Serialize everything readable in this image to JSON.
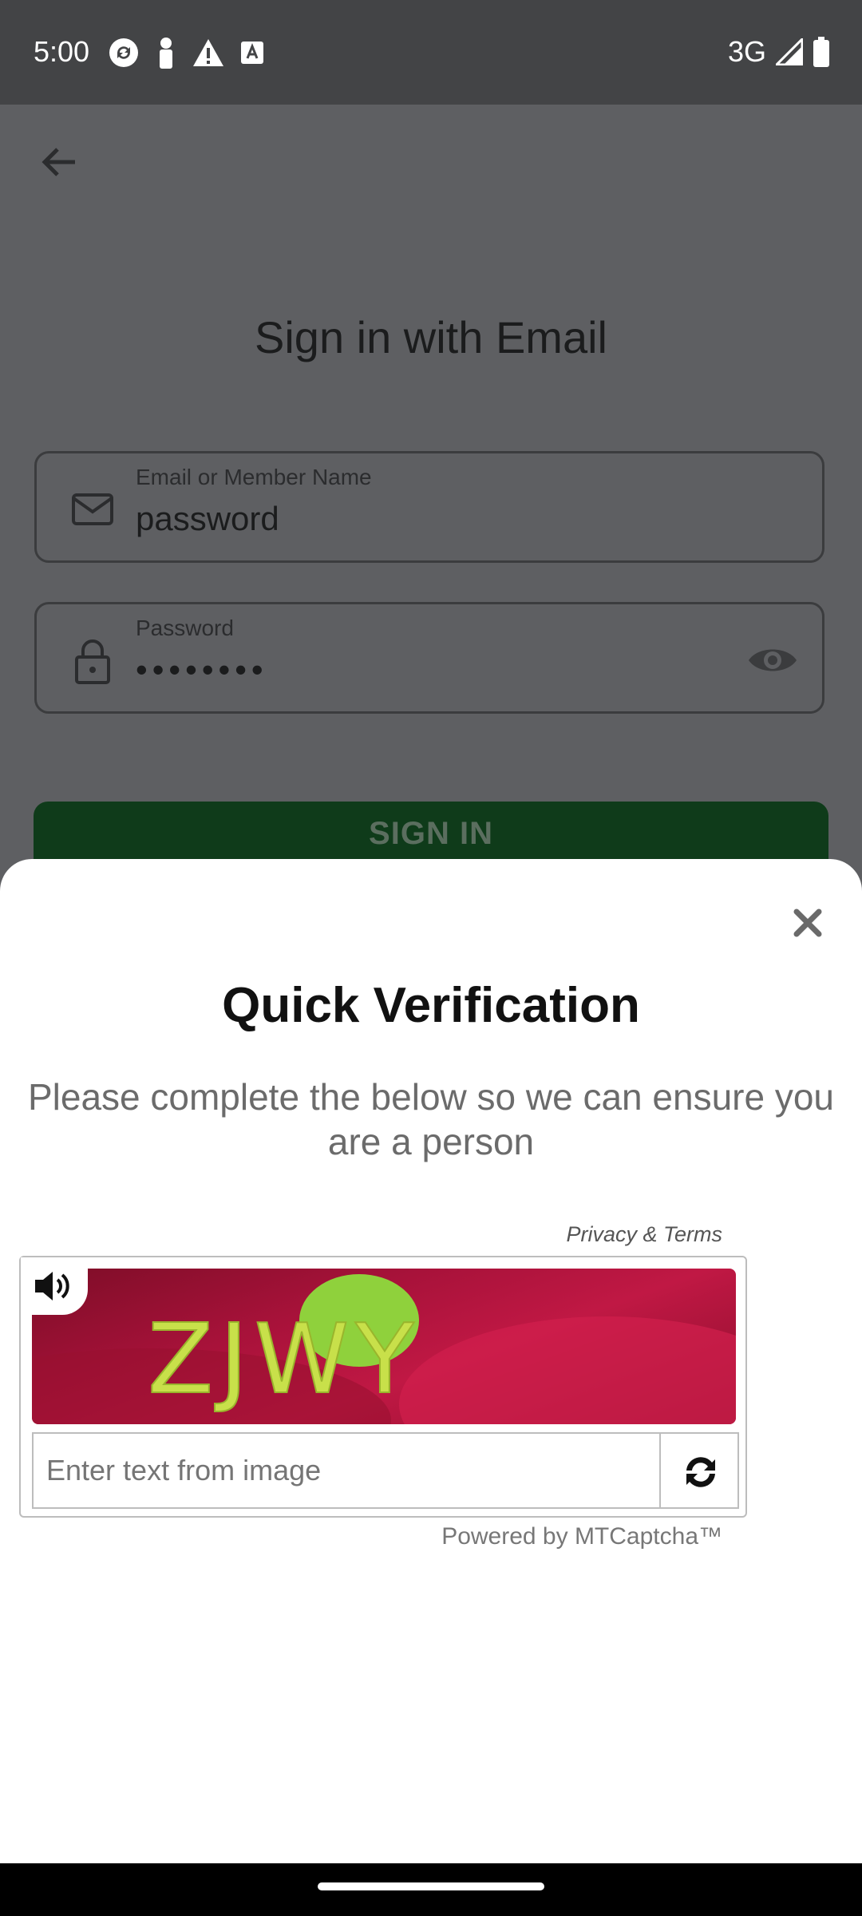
{
  "status_bar": {
    "time": "5:00",
    "network": "3G",
    "icons_left": [
      "sync-icon",
      "person-icon",
      "warning-icon",
      "font-icon"
    ],
    "icons_right": [
      "signal-icon",
      "battery-icon"
    ]
  },
  "background": {
    "back_icon": "arrow-left-icon",
    "title": "Sign in with Email",
    "email_field": {
      "label": "Email or Member Name",
      "value": "password"
    },
    "password_field": {
      "label": "Password",
      "value": "••••••••"
    },
    "signin_label": "SIGN IN"
  },
  "dialog": {
    "title": "Quick Verification",
    "subtitle": "Please complete the below so we can ensure you are a person",
    "privacy_link": "Privacy & Terms",
    "captcha": {
      "image_text": "ZJWY",
      "input_placeholder": "Enter text from image"
    },
    "powered_by": "Powered by MTCaptcha™"
  },
  "colors": {
    "signin_button": "#0f3b1a",
    "captcha_bg": "#b3143e",
    "captcha_text": "#c8e04a"
  }
}
